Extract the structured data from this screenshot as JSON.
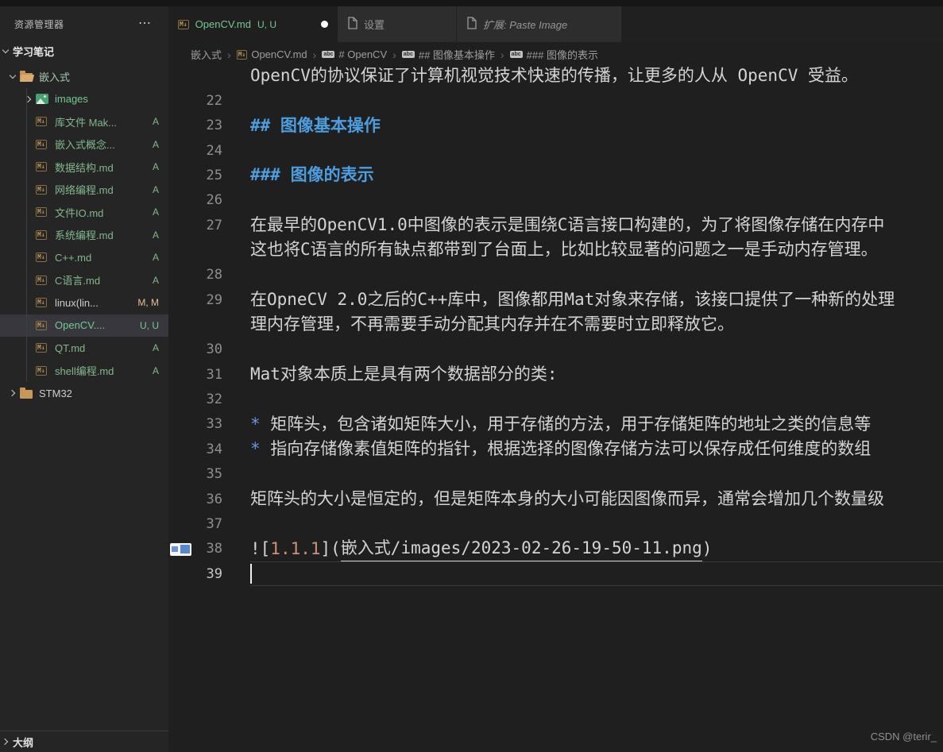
{
  "colors": {
    "accent_green": "#73c991",
    "added_green": "#81b88b",
    "modified_tan": "#e2c08d",
    "heading_blue": "#4d9ee0",
    "alt_salmon": "#ce9178",
    "editor_bg": "#1f1f1f",
    "sidebar_bg": "#252526"
  },
  "sidebar": {
    "header": "资源管理器",
    "more_icon": "⋯",
    "section": "学习笔记",
    "outline": "大纲",
    "tree": [
      {
        "icon": "folder-open",
        "label": "嵌入式",
        "level": 0,
        "chevron": "down",
        "dot": true,
        "color": "softgreen"
      },
      {
        "icon": "image",
        "label": "images",
        "level": 1,
        "chevron": "right",
        "dot": true,
        "color": "untracked"
      },
      {
        "icon": "md",
        "label": "库文件 Mak...",
        "level": 1,
        "status": "A",
        "color": "added",
        "statusColor": "added"
      },
      {
        "icon": "md",
        "label": "嵌入式概念...",
        "level": 1,
        "status": "A",
        "color": "added",
        "statusColor": "added"
      },
      {
        "icon": "md",
        "label": "数据结构.md",
        "level": 1,
        "status": "A",
        "color": "added",
        "statusColor": "added"
      },
      {
        "icon": "md",
        "label": "网络编程.md",
        "level": 1,
        "status": "A",
        "color": "added",
        "statusColor": "added"
      },
      {
        "icon": "md",
        "label": "文件IO.md",
        "level": 1,
        "status": "A",
        "color": "added",
        "statusColor": "added"
      },
      {
        "icon": "md",
        "label": "系统编程.md",
        "level": 1,
        "status": "A",
        "color": "added",
        "statusColor": "added"
      },
      {
        "icon": "md",
        "label": "C++.md",
        "level": 1,
        "status": "A",
        "color": "added",
        "statusColor": "added"
      },
      {
        "icon": "md",
        "label": "C语言.md",
        "level": 1,
        "status": "A",
        "color": "added",
        "statusColor": "added"
      },
      {
        "icon": "md",
        "label": "linux(lin...",
        "level": 1,
        "status": "M, M",
        "color": "plain",
        "statusColor": "modified"
      },
      {
        "icon": "md",
        "label": "OpenCV....",
        "level": 1,
        "status": "U, U",
        "color": "untracked",
        "statusColor": "untracked",
        "selected": true
      },
      {
        "icon": "md",
        "label": "QT.md",
        "level": 1,
        "status": "A",
        "color": "added",
        "statusColor": "added"
      },
      {
        "icon": "md",
        "label": "shell编程.md",
        "level": 1,
        "status": "A",
        "color": "added",
        "statusColor": "added"
      },
      {
        "icon": "folder",
        "label": "STM32",
        "level": 0,
        "chevron": "right",
        "color": "plain"
      }
    ]
  },
  "tabs": [
    {
      "label": "OpenCV.md",
      "status": "U, U",
      "icon": "md",
      "active": true,
      "dirty": true
    },
    {
      "label": "设置",
      "icon": "file",
      "active": false
    },
    {
      "label": "扩展: Paste Image",
      "icon": "file",
      "active": false,
      "italic": true
    }
  ],
  "breadcrumb": [
    {
      "label": "嵌入式"
    },
    {
      "label": "OpenCV.md",
      "icon": "md"
    },
    {
      "label": "# OpenCV",
      "icon": "abc"
    },
    {
      "label": "## 图像基本操作",
      "icon": "abc"
    },
    {
      "label": "### 图像的表示",
      "icon": "abc"
    }
  ],
  "editor": {
    "rows": [
      {
        "num": "",
        "segs": [
          {
            "t": "OpenCV的协议保证了计算机视觉技术快速的传播，让更多的人从 OpenCV 受益。"
          }
        ]
      },
      {
        "num": "22"
      },
      {
        "num": "23",
        "segs": [
          {
            "t": "## 图像基本操作",
            "c": "heading"
          }
        ]
      },
      {
        "num": "24"
      },
      {
        "num": "25",
        "segs": [
          {
            "t": "### 图像的表示",
            "c": "heading"
          }
        ]
      },
      {
        "num": "26"
      },
      {
        "num": "27",
        "segs": [
          {
            "t": "在最早的OpenCV1.0中图像的表示是围绕C语言接口构建的，为了将图像存储在内存中"
          }
        ]
      },
      {
        "num": "",
        "segs": [
          {
            "t": "这也将C语言的所有缺点都带到了台面上，比如比较显著的问题之一是手动内存管理。"
          }
        ]
      },
      {
        "num": "28"
      },
      {
        "num": "29",
        "segs": [
          {
            "t": "在OpneCV 2.0之后的C++库中，图像都用Mat对象来存储，该接口提供了一种新的处理"
          }
        ]
      },
      {
        "num": "",
        "segs": [
          {
            "t": "理内存管理，不再需要手动分配其内存并在不需要时立即释放它。"
          }
        ]
      },
      {
        "num": "30"
      },
      {
        "num": "31",
        "segs": [
          {
            "t": "Mat对象本质上是具有两个数据部分的类:"
          }
        ]
      },
      {
        "num": "32"
      },
      {
        "num": "33",
        "segs": [
          {
            "t": "* ",
            "c": "bullet"
          },
          {
            "t": "矩阵头，包含诸如矩阵大小，用于存储的方法，用于存储矩阵的地址之类的信息等"
          }
        ]
      },
      {
        "num": "34",
        "segs": [
          {
            "t": "* ",
            "c": "bullet"
          },
          {
            "t": "指向存储像素值矩阵的指针，根据选择的图像存储方法可以保存成任何维度的数组"
          }
        ]
      },
      {
        "num": "35"
      },
      {
        "num": "36",
        "segs": [
          {
            "t": "矩阵头的大小是恒定的，但是矩阵本身的大小可能因图像而异，通常会增加几个数量级"
          }
        ]
      },
      {
        "num": "37"
      },
      {
        "num": "38",
        "thumb": true,
        "segs": [
          {
            "t": "!["
          },
          {
            "t": "1.1.1",
            "c": "alt"
          },
          {
            "t": "]("
          },
          {
            "t": "嵌入式/images/2023-02-26-19-50-11.png",
            "c": "link"
          },
          {
            "t": ")"
          }
        ]
      },
      {
        "num": "39",
        "active": true,
        "cursor": true
      }
    ]
  },
  "watermark": "CSDN @terir_"
}
